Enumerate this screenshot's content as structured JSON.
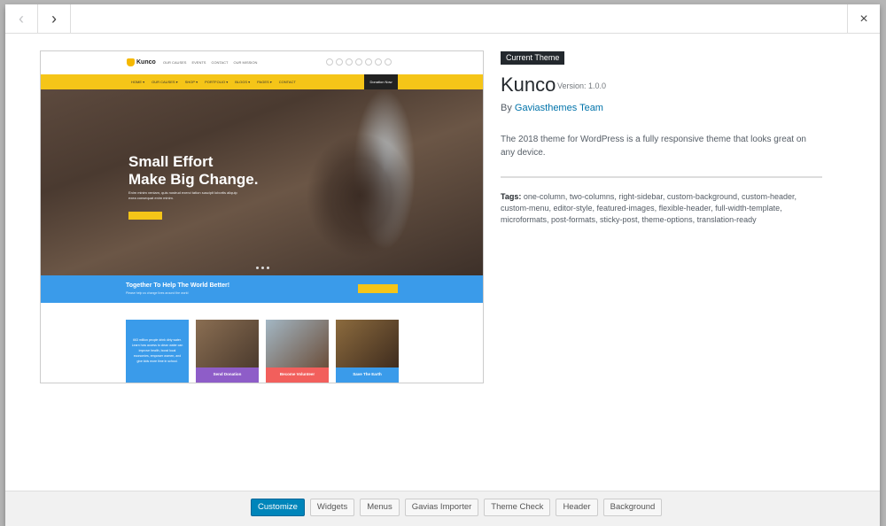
{
  "nav": {
    "prev_icon": "chevron-left-icon",
    "next_icon": "chevron-right-icon",
    "close_icon": "close-icon",
    "prev_glyph": "‹",
    "next_glyph": "›",
    "close_glyph": "×"
  },
  "screenshot": {
    "logo": "Kunco",
    "top_links": [
      "OUR CAUSES",
      "EVENTS",
      "CONTACT",
      "OUR MISSION"
    ],
    "nav_links": [
      "HOME ▾",
      "OUR CAUSES ▾",
      "SHOP ▾",
      "PORTFOLIO ▾",
      "BLOGS ▾",
      "PAGES ▾",
      "CONTACT"
    ],
    "donate": "Donation Now",
    "hero_title_line1": "Small Effort",
    "hero_title_line2": "Make Big Change.",
    "hero_sub": "Enim minim veniam, quis nostrud exerci tation suscipit lobortis aliquip exea consequat enim minim.",
    "band_title": "Together To Help The World Better!",
    "band_sub": "Please help us change lives around the world",
    "card_text": "663 million people drink dirty water. Learn how access to clean water can improve health, boost local economies, empower women, and give kids more time in school.",
    "cards": [
      "Send Donation",
      "Become Volunteer",
      "Save The Earth"
    ],
    "card_colors": [
      "#8e5dc8",
      "#f25f5c",
      "#3a9bea"
    ]
  },
  "theme": {
    "badge": "Current Theme",
    "name": "Kunco",
    "version": "Version: 1.0.0",
    "by": "By",
    "author": "Gaviasthemes Team",
    "description": "The 2018 theme for WordPress is a fully responsive theme that looks great on any device.",
    "tags_label": "Tags:",
    "tags": "one-column, two-columns, right-sidebar, custom-background, custom-header, custom-menu, editor-style, featured-images, flexible-header, full-width-template, microformats, post-formats, sticky-post, theme-options, translation-ready"
  },
  "footer": {
    "buttons": [
      "Customize",
      "Widgets",
      "Menus",
      "Gavias Importer",
      "Theme Check",
      "Header",
      "Background"
    ]
  },
  "colors": {
    "accent": "#0085ba",
    "yellow": "#f5c518",
    "blue": "#3a9bea"
  }
}
